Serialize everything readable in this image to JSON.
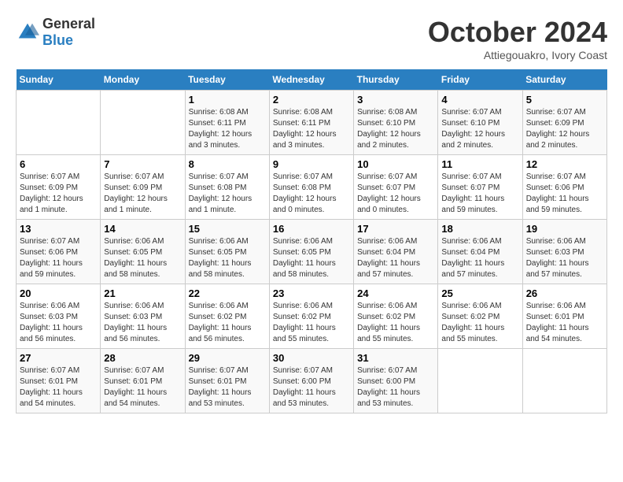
{
  "app": {
    "logo_general": "General",
    "logo_blue": "Blue"
  },
  "header": {
    "month": "October 2024",
    "location": "Attiegouakro, Ivory Coast"
  },
  "days_of_week": [
    "Sunday",
    "Monday",
    "Tuesday",
    "Wednesday",
    "Thursday",
    "Friday",
    "Saturday"
  ],
  "weeks": [
    [
      {
        "day": "",
        "info": ""
      },
      {
        "day": "",
        "info": ""
      },
      {
        "day": "1",
        "info": "Sunrise: 6:08 AM\nSunset: 6:11 PM\nDaylight: 12 hours and 3 minutes."
      },
      {
        "day": "2",
        "info": "Sunrise: 6:08 AM\nSunset: 6:11 PM\nDaylight: 12 hours and 3 minutes."
      },
      {
        "day": "3",
        "info": "Sunrise: 6:08 AM\nSunset: 6:10 PM\nDaylight: 12 hours and 2 minutes."
      },
      {
        "day": "4",
        "info": "Sunrise: 6:07 AM\nSunset: 6:10 PM\nDaylight: 12 hours and 2 minutes."
      },
      {
        "day": "5",
        "info": "Sunrise: 6:07 AM\nSunset: 6:09 PM\nDaylight: 12 hours and 2 minutes."
      }
    ],
    [
      {
        "day": "6",
        "info": "Sunrise: 6:07 AM\nSunset: 6:09 PM\nDaylight: 12 hours and 1 minute."
      },
      {
        "day": "7",
        "info": "Sunrise: 6:07 AM\nSunset: 6:09 PM\nDaylight: 12 hours and 1 minute."
      },
      {
        "day": "8",
        "info": "Sunrise: 6:07 AM\nSunset: 6:08 PM\nDaylight: 12 hours and 1 minute."
      },
      {
        "day": "9",
        "info": "Sunrise: 6:07 AM\nSunset: 6:08 PM\nDaylight: 12 hours and 0 minutes."
      },
      {
        "day": "10",
        "info": "Sunrise: 6:07 AM\nSunset: 6:07 PM\nDaylight: 12 hours and 0 minutes."
      },
      {
        "day": "11",
        "info": "Sunrise: 6:07 AM\nSunset: 6:07 PM\nDaylight: 11 hours and 59 minutes."
      },
      {
        "day": "12",
        "info": "Sunrise: 6:07 AM\nSunset: 6:06 PM\nDaylight: 11 hours and 59 minutes."
      }
    ],
    [
      {
        "day": "13",
        "info": "Sunrise: 6:07 AM\nSunset: 6:06 PM\nDaylight: 11 hours and 59 minutes."
      },
      {
        "day": "14",
        "info": "Sunrise: 6:06 AM\nSunset: 6:05 PM\nDaylight: 11 hours and 58 minutes."
      },
      {
        "day": "15",
        "info": "Sunrise: 6:06 AM\nSunset: 6:05 PM\nDaylight: 11 hours and 58 minutes."
      },
      {
        "day": "16",
        "info": "Sunrise: 6:06 AM\nSunset: 6:05 PM\nDaylight: 11 hours and 58 minutes."
      },
      {
        "day": "17",
        "info": "Sunrise: 6:06 AM\nSunset: 6:04 PM\nDaylight: 11 hours and 57 minutes."
      },
      {
        "day": "18",
        "info": "Sunrise: 6:06 AM\nSunset: 6:04 PM\nDaylight: 11 hours and 57 minutes."
      },
      {
        "day": "19",
        "info": "Sunrise: 6:06 AM\nSunset: 6:03 PM\nDaylight: 11 hours and 57 minutes."
      }
    ],
    [
      {
        "day": "20",
        "info": "Sunrise: 6:06 AM\nSunset: 6:03 PM\nDaylight: 11 hours and 56 minutes."
      },
      {
        "day": "21",
        "info": "Sunrise: 6:06 AM\nSunset: 6:03 PM\nDaylight: 11 hours and 56 minutes."
      },
      {
        "day": "22",
        "info": "Sunrise: 6:06 AM\nSunset: 6:02 PM\nDaylight: 11 hours and 56 minutes."
      },
      {
        "day": "23",
        "info": "Sunrise: 6:06 AM\nSunset: 6:02 PM\nDaylight: 11 hours and 55 minutes."
      },
      {
        "day": "24",
        "info": "Sunrise: 6:06 AM\nSunset: 6:02 PM\nDaylight: 11 hours and 55 minutes."
      },
      {
        "day": "25",
        "info": "Sunrise: 6:06 AM\nSunset: 6:02 PM\nDaylight: 11 hours and 55 minutes."
      },
      {
        "day": "26",
        "info": "Sunrise: 6:06 AM\nSunset: 6:01 PM\nDaylight: 11 hours and 54 minutes."
      }
    ],
    [
      {
        "day": "27",
        "info": "Sunrise: 6:07 AM\nSunset: 6:01 PM\nDaylight: 11 hours and 54 minutes."
      },
      {
        "day": "28",
        "info": "Sunrise: 6:07 AM\nSunset: 6:01 PM\nDaylight: 11 hours and 54 minutes."
      },
      {
        "day": "29",
        "info": "Sunrise: 6:07 AM\nSunset: 6:01 PM\nDaylight: 11 hours and 53 minutes."
      },
      {
        "day": "30",
        "info": "Sunrise: 6:07 AM\nSunset: 6:00 PM\nDaylight: 11 hours and 53 minutes."
      },
      {
        "day": "31",
        "info": "Sunrise: 6:07 AM\nSunset: 6:00 PM\nDaylight: 11 hours and 53 minutes."
      },
      {
        "day": "",
        "info": ""
      },
      {
        "day": "",
        "info": ""
      }
    ]
  ]
}
